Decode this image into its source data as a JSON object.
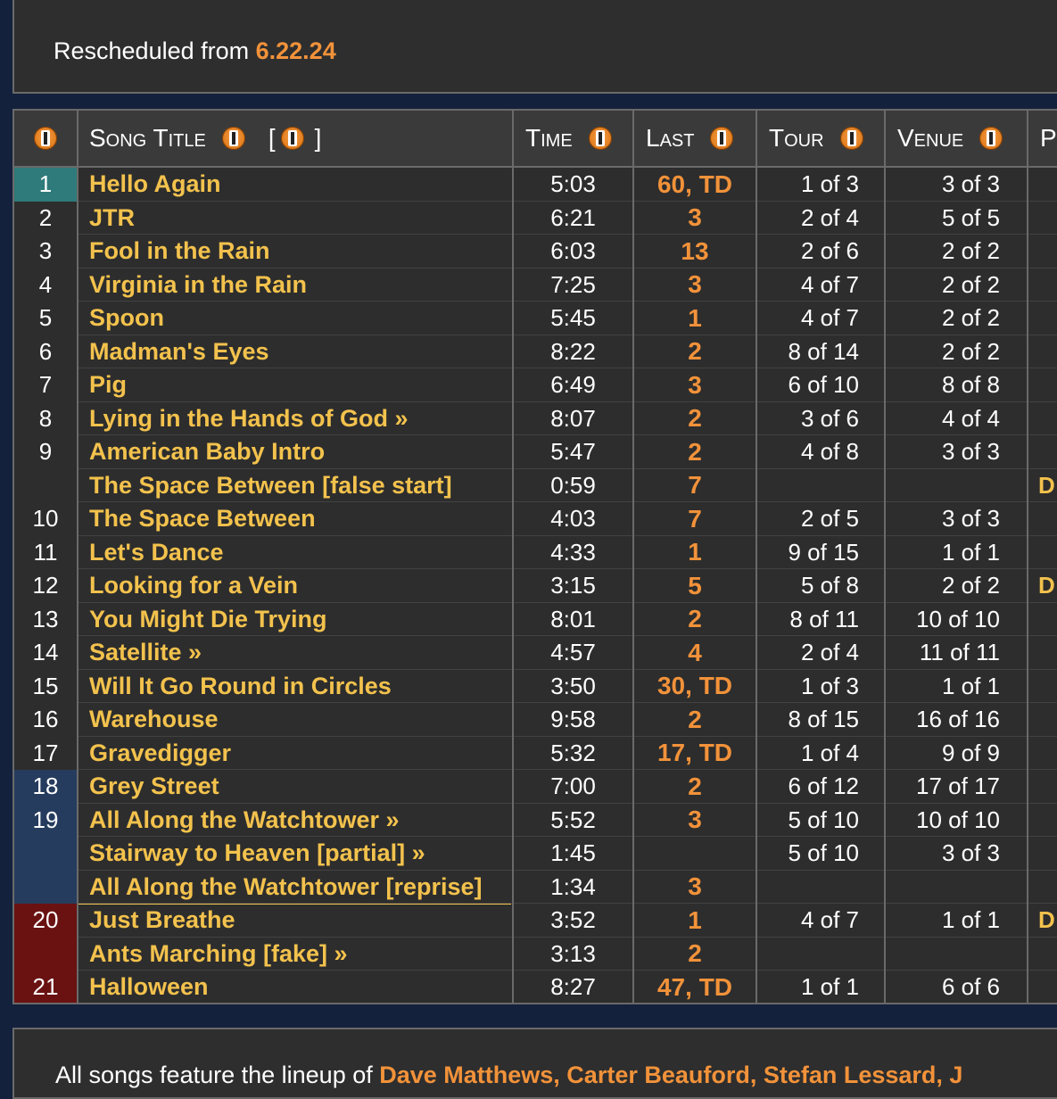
{
  "header_note": {
    "prefix": "Rescheduled from ",
    "date": "6.22.24"
  },
  "columns": {
    "song_title": "Song Title",
    "bracket_open": "[",
    "bracket_close": "]",
    "time": "Time",
    "last": "Last",
    "tour": "Tour",
    "venue": "Venue",
    "partial_p": "P"
  },
  "colors": {
    "accent_orange": "#f2923a",
    "song_yellow": "#f3c24d",
    "teal_opener": "#2f7a7a",
    "blue_set_end": "#263c5e",
    "red_encore": "#6a1212"
  },
  "songs": [
    {
      "num": "1",
      "title": "Hello Again",
      "time": "5:03",
      "last": "60, TD",
      "tour": "1 of 3",
      "venue": "3 of 3",
      "p": ""
    },
    {
      "num": "2",
      "title": "JTR",
      "time": "6:21",
      "last": "3",
      "tour": "2 of 4",
      "venue": "5 of 5",
      "p": ""
    },
    {
      "num": "3",
      "title": "Fool in the Rain",
      "time": "6:03",
      "last": "13",
      "tour": "2 of 6",
      "venue": "2 of 2",
      "p": ""
    },
    {
      "num": "4",
      "title": "Virginia in the Rain",
      "time": "7:25",
      "last": "3",
      "tour": "4 of 7",
      "venue": "2 of 2",
      "p": ""
    },
    {
      "num": "5",
      "title": "Spoon",
      "time": "5:45",
      "last": "1",
      "tour": "4 of 7",
      "venue": "2 of 2",
      "p": ""
    },
    {
      "num": "6",
      "title": "Madman's Eyes",
      "time": "8:22",
      "last": "2",
      "tour": "8 of 14",
      "venue": "2 of 2",
      "p": ""
    },
    {
      "num": "7",
      "title": "Pig",
      "time": "6:49",
      "last": "3",
      "tour": "6 of 10",
      "venue": "8 of 8",
      "p": ""
    },
    {
      "num": "8",
      "title": "Lying in the Hands of God »",
      "time": "8:07",
      "last": "2",
      "tour": "3 of 6",
      "venue": "4 of 4",
      "p": ""
    },
    {
      "num": "9",
      "title": "American Baby Intro",
      "time": "5:47",
      "last": "2",
      "tour": "4 of 8",
      "venue": "3 of 3",
      "p": ""
    },
    {
      "num": "",
      "title": "The Space Between [false start]",
      "time": "0:59",
      "last": "7",
      "tour": "",
      "venue": "",
      "p": "D"
    },
    {
      "num": "10",
      "title": "The Space Between",
      "time": "4:03",
      "last": "7",
      "tour": "2 of 5",
      "venue": "3 of 3",
      "p": ""
    },
    {
      "num": "11",
      "title": "Let's Dance",
      "time": "4:33",
      "last": "1",
      "tour": "9 of 15",
      "venue": "1 of 1",
      "p": ""
    },
    {
      "num": "12",
      "title": "Looking for a Vein",
      "time": "3:15",
      "last": "5",
      "tour": "5 of 8",
      "venue": "2 of 2",
      "p": "D"
    },
    {
      "num": "13",
      "title": "You Might Die Trying",
      "time": "8:01",
      "last": "2",
      "tour": "8 of 11",
      "venue": "10 of 10",
      "p": ""
    },
    {
      "num": "14",
      "title": "Satellite »",
      "time": "4:57",
      "last": "4",
      "tour": "2 of 4",
      "venue": "11 of 11",
      "p": ""
    },
    {
      "num": "15",
      "title": "Will It Go Round in Circles",
      "time": "3:50",
      "last": "30, TD",
      "tour": "1 of 3",
      "venue": "1 of 1",
      "p": ""
    },
    {
      "num": "16",
      "title": "Warehouse",
      "time": "9:58",
      "last": "2",
      "tour": "8 of 15",
      "venue": "16 of 16",
      "p": ""
    },
    {
      "num": "17",
      "title": "Gravedigger",
      "time": "5:32",
      "last": "17, TD",
      "tour": "1 of 4",
      "venue": "9 of 9",
      "p": ""
    },
    {
      "num": "18",
      "title": "Grey Street",
      "time": "7:00",
      "last": "2",
      "tour": "6 of 12",
      "venue": "17 of 17",
      "p": ""
    },
    {
      "num": "19",
      "title": "All Along the Watchtower »",
      "time": "5:52",
      "last": "3",
      "tour": "5 of 10",
      "venue": "10 of 10",
      "p": ""
    },
    {
      "num": "",
      "title": "Stairway to Heaven [partial] »",
      "time": "1:45",
      "last": "",
      "tour": "5 of 10",
      "venue": "3 of 3",
      "p": ""
    },
    {
      "num": "",
      "title": "All Along the Watchtower [reprise]",
      "time": "1:34",
      "last": "3",
      "tour": "",
      "venue": "",
      "p": ""
    },
    {
      "num": "20",
      "title": "Just Breathe",
      "time": "3:52",
      "last": "1",
      "tour": "4 of 7",
      "venue": "1 of 1",
      "p": "D"
    },
    {
      "num": "",
      "title": "Ants Marching [fake] »",
      "time": "3:13",
      "last": "2",
      "tour": "",
      "venue": "",
      "p": ""
    },
    {
      "num": "21",
      "title": "Halloween",
      "time": "8:27",
      "last": "47, TD",
      "tour": "1 of 1",
      "venue": "6 of 6",
      "p": ""
    }
  ],
  "footer": {
    "prefix": "All songs feature the lineup of ",
    "names": "Dave Matthews, Carter Beauford, Stefan Lessard, J"
  }
}
